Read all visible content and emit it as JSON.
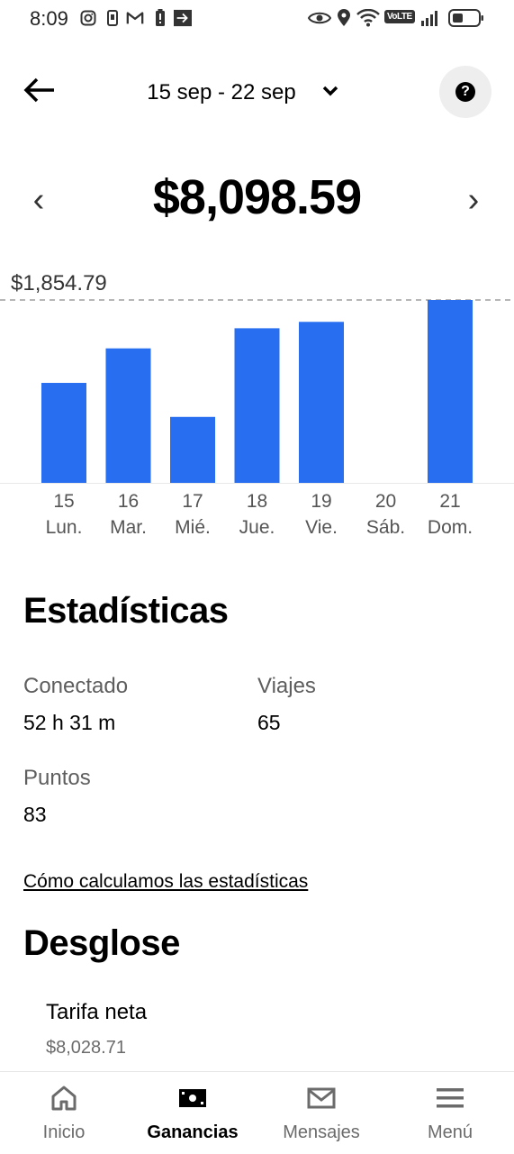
{
  "status_bar": {
    "time": "8:09",
    "volte_label": "VoLTE",
    "icons": [
      "instagram-icon",
      "phone-icon",
      "gmail-icon",
      "alert-icon",
      "arrow-forward-icon",
      "eye-icon",
      "location-icon",
      "wifi-icon",
      "volte-icon",
      "signal-icon",
      "battery-icon"
    ]
  },
  "header": {
    "date_range": "15 sep - 22 sep",
    "back_icon": "arrow-left-icon",
    "dropdown_icon": "chevron-down-icon",
    "help_symbol": "?"
  },
  "summary": {
    "prev_symbol": "‹",
    "next_symbol": "›",
    "total": "$8,098.59"
  },
  "chart_data": {
    "type": "bar",
    "max_label": "$1,854.79",
    "max_value": 1854.79,
    "bar_color": "#276ef1",
    "categories": [
      {
        "day": "15",
        "weekday": "Lun."
      },
      {
        "day": "16",
        "weekday": "Mar."
      },
      {
        "day": "17",
        "weekday": "Mié."
      },
      {
        "day": "18",
        "weekday": "Jue."
      },
      {
        "day": "19",
        "weekday": "Vie."
      },
      {
        "day": "20",
        "weekday": "Sáb."
      },
      {
        "day": "21",
        "weekday": "Dom."
      }
    ],
    "values": [
      1014,
      1364,
      669,
      1568,
      1633,
      0,
      1854.79
    ]
  },
  "stats": {
    "title": "Estadísticas",
    "items": [
      {
        "label": "Conectado",
        "value": "52 h 31 m"
      },
      {
        "label": "Viajes",
        "value": "65"
      },
      {
        "label": "Puntos",
        "value": "83"
      }
    ],
    "link": "Cómo calculamos las estadísticas"
  },
  "breakdown": {
    "title": "Desglose",
    "items": [
      {
        "label": "Tarifa neta",
        "value": "$8,028.71"
      }
    ]
  },
  "nav": {
    "items": [
      {
        "label": "Inicio",
        "icon": "home-icon"
      },
      {
        "label": "Ganancias",
        "icon": "earnings-icon",
        "active": true
      },
      {
        "label": "Mensajes",
        "icon": "mail-icon"
      },
      {
        "label": "Menú",
        "icon": "menu-icon"
      }
    ]
  }
}
